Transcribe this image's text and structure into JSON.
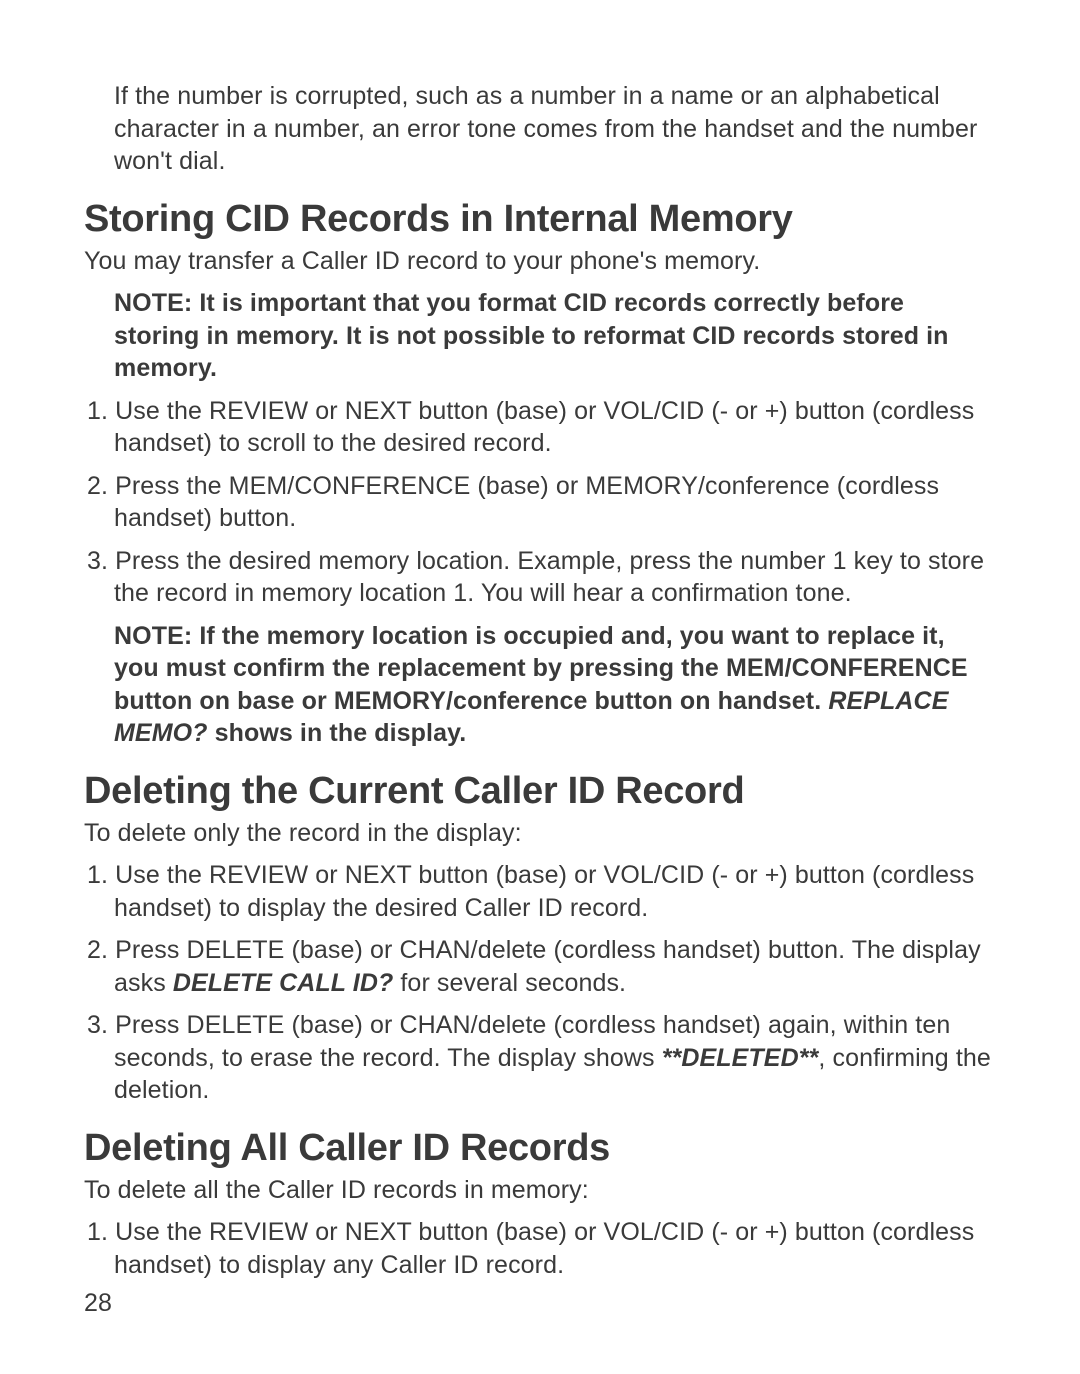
{
  "intro_para": "If the number is corrupted, such as a number in a name or an alphabetical character in a number, an error tone comes from the handset and the number won't dial.",
  "section1": {
    "heading": "Storing CID Records in Internal Memory",
    "lead": "You may transfer a Caller ID record to your phone's memory.",
    "note1": "NOTE: It is important that you format CID records correctly before storing in memory. It is not possible to reformat CID records stored in memory.",
    "steps": {
      "s1_marker": "1.",
      "s1": " Use the REVIEW or NEXT button (base) or VOL/CID (- or +) button (cordless handset) to scroll to the desired record.",
      "s2_marker": "2.",
      "s2": " Press the MEM/CONFERENCE (base) or MEMORY/conference (cordless handset) button.",
      "s3_marker": "3.",
      "s3": " Press the desired memory location. Example, press the number 1 key to store the record in memory location 1. You will hear a confirmation tone."
    },
    "note2_pre": "NOTE: If the memory location is occupied and, you want to replace it, you must confirm the replacement by pressing the MEM/CONFERENCE button on base or MEMORY/conference button on handset. ",
    "note2_em": "REPLACE MEMO?",
    "note2_post": " shows in the display."
  },
  "section2": {
    "heading": "Deleting the Current Caller ID Record",
    "lead": "To delete only the record in the display:",
    "steps": {
      "s1_marker": "1.",
      "s1": " Use the REVIEW or NEXT button (base) or VOL/CID (- or +) button (cordless handset) to display the desired Caller ID record.",
      "s2_marker": "2.",
      "s2_pre": " Press DELETE (base) or CHAN/delete (cordless handset) button. The display asks ",
      "s2_em": "DELETE CALL ID?",
      "s2_post": " for several seconds.",
      "s3_marker": "3.",
      "s3_pre": " Press DELETE (base) or CHAN/delete (cordless handset) again, within ten seconds, to erase the record. The display shows ",
      "s3_em": "**DELETED**",
      "s3_post": ", confirming the deletion."
    }
  },
  "section3": {
    "heading": "Deleting All Caller ID Records",
    "lead": "To delete all the Caller ID records in memory:",
    "steps": {
      "s1_marker": "1.",
      "s1": " Use the REVIEW or NEXT button (base) or VOL/CID (- or +) button (cordless handset) to display any Caller ID record."
    }
  },
  "page_number": "28"
}
